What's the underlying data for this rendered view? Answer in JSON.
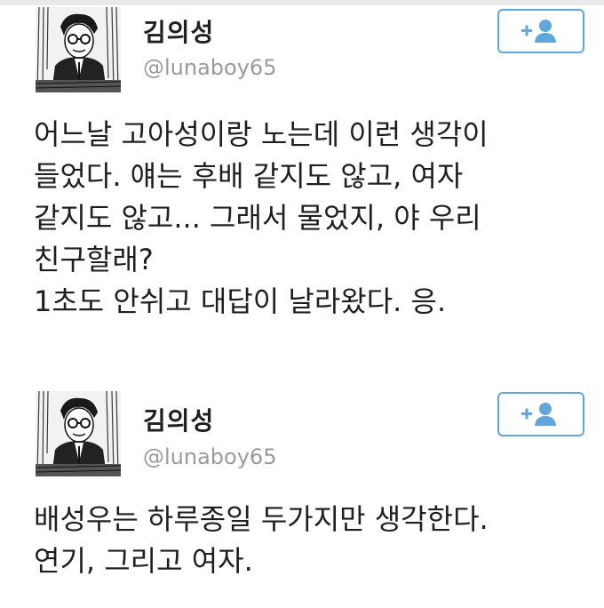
{
  "tweets": [
    {
      "display_name": "김의성",
      "handle": "@lunaboy65",
      "follow_icon": "add-user-icon",
      "body_lines": [
        "어느날 고아성이랑 노는데 이런 생각이",
        "들었다. 얘는 후배 같지도 않고, 여자",
        "같지도 않고... 그래서 물었지, 야 우리",
        "친구할래?",
        "1초도 안쉬고 대답이 날라왔다. 응."
      ]
    },
    {
      "display_name": "김의성",
      "handle": "@lunaboy65",
      "follow_icon": "add-user-icon",
      "body_lines": [
        "배성우는 하루종일 두가지만 생각한다.",
        "연기, 그리고 여자."
      ]
    }
  ],
  "colors": {
    "accent": "#5fa7dc",
    "text": "#1f1f1f",
    "handle": "#9a9a9a"
  }
}
